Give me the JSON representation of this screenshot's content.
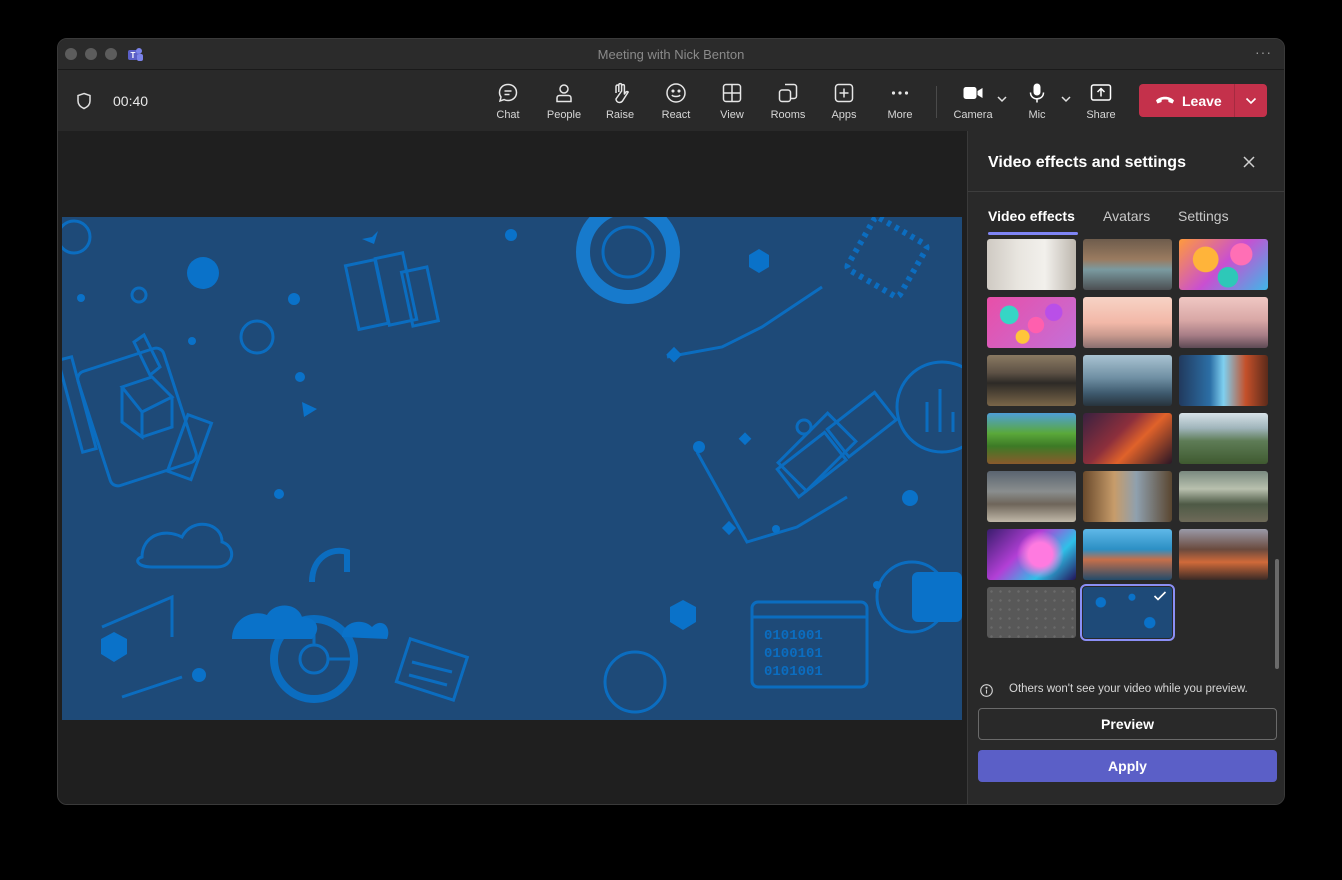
{
  "window": {
    "title": "Meeting with Nick Benton",
    "more_glyph": "···"
  },
  "toolbar": {
    "timer": "00:40",
    "buttons": {
      "chat": "Chat",
      "people": "People",
      "raise": "Raise",
      "react": "React",
      "view": "View",
      "rooms": "Rooms",
      "apps": "Apps",
      "more": "More",
      "camera": "Camera",
      "mic": "Mic",
      "share": "Share"
    },
    "leave": "Leave",
    "leave_color": "#c4314b"
  },
  "panel": {
    "title": "Video effects and settings",
    "tabs": [
      "Video effects",
      "Avatars",
      "Settings"
    ],
    "active_tab": "Video effects",
    "backgrounds": [
      "white-room",
      "office-glass",
      "balloons-orange",
      "pink-spheres",
      "bridge-sunset",
      "pink-canyon",
      "classroom",
      "futuristic-lab",
      "minecraft-waterfall",
      "minecraft-village",
      "minecraft-nether",
      "mountain-valley",
      "halo-ring",
      "desert-street",
      "alien-hillside",
      "purple-nebula",
      "beach-island",
      "sunset-town",
      "grey-dots",
      "blue-tech-icons"
    ],
    "selected_background": "blue-tech-icons",
    "info": "Others won't see your video while you preview.",
    "preview": "Preview",
    "apply": "Apply",
    "accent_color": "#5b5fc7"
  }
}
